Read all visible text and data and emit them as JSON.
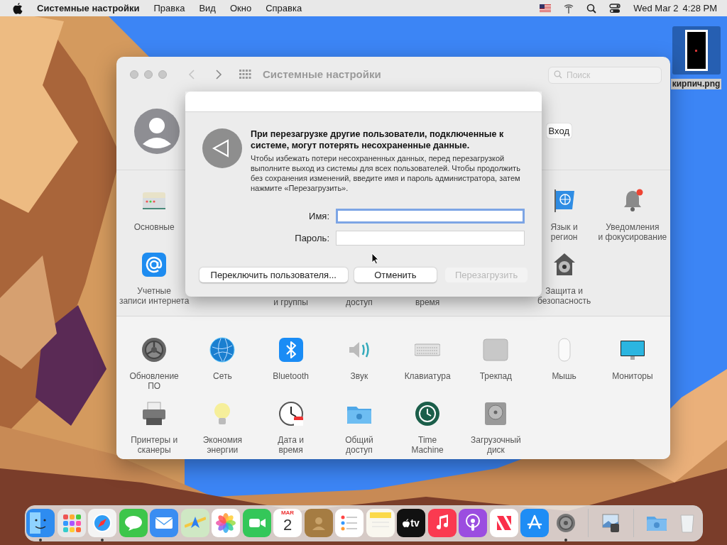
{
  "menu_bar": {
    "app_name": "Системные настройки",
    "menus": [
      "Правка",
      "Вид",
      "Окно",
      "Справка"
    ],
    "date": "Wed Mar 2",
    "time": "4:28 PM"
  },
  "desktop_file": {
    "name": "кирпич.png",
    "selected": true
  },
  "window": {
    "title": "Системные настройки",
    "search": {
      "placeholder": "Поиск"
    },
    "login_button": "Вход",
    "sections": [
      {
        "rows": [
          [
            {
              "kind": "general",
              "label": "Основные"
            },
            {
              "kind": "empty"
            },
            {
              "kind": "empty"
            },
            {
              "kind": "empty"
            },
            {
              "kind": "empty"
            },
            {
              "kind": "empty"
            },
            {
              "kind": "language",
              "label": "Язык и\nрегион"
            },
            {
              "kind": "notifications",
              "label": "Уведомления\nи фокусирование"
            }
          ],
          [
            {
              "kind": "internet",
              "label": "Учетные\nзаписи интернета"
            },
            {
              "kind": "empty"
            },
            {
              "kind": "covered",
              "label": "и группы"
            },
            {
              "kind": "covered",
              "label": "доступ"
            },
            {
              "kind": "covered",
              "label": "время"
            },
            {
              "kind": "empty"
            },
            {
              "kind": "security",
              "label": "Защита и\nбезопасность"
            },
            {
              "kind": "empty"
            }
          ]
        ]
      },
      {
        "rows": [
          [
            {
              "kind": "update",
              "label": "Обновление\nПО"
            },
            {
              "kind": "network",
              "label": "Сеть"
            },
            {
              "kind": "bluetooth",
              "label": "Bluetooth"
            },
            {
              "kind": "sound",
              "label": "Звук"
            },
            {
              "kind": "keyboard",
              "label": "Клавиатура"
            },
            {
              "kind": "trackpad",
              "label": "Трекпад"
            },
            {
              "kind": "mouse",
              "label": "Мышь"
            },
            {
              "kind": "displays",
              "label": "Мониторы"
            }
          ],
          [
            {
              "kind": "printers",
              "label": "Принтеры и\nсканеры"
            },
            {
              "kind": "energy",
              "label": "Экономия\nэнергии"
            },
            {
              "kind": "datetime",
              "label": "Дата и\nвремя"
            },
            {
              "kind": "sharing",
              "label": "Общий\nдоступ"
            },
            {
              "kind": "timemachine",
              "label": "Time\nMachine"
            },
            {
              "kind": "disk",
              "label": "Загрузочный\nдиск"
            },
            {
              "kind": "empty"
            },
            {
              "kind": "empty"
            }
          ]
        ]
      }
    ]
  },
  "sheet": {
    "title": "При перезагрузке другие пользователи, подключенные к системе, могут потерять несохраненные данные.",
    "message": "Чтобы избежать потери несохраненных данных, перед перезагрузкой выполните выход из системы для всех пользователей. Чтобы продолжить без сохранения изменений, введите имя и пароль администратора, затем нажмите «Перезагрузить».",
    "fields": [
      {
        "label": "Имя:",
        "focused": true
      },
      {
        "label": "Пароль:",
        "focused": false
      }
    ],
    "buttons": [
      {
        "label": "Переключить пользователя...",
        "disabled": false
      },
      {
        "label": "Отменить",
        "disabled": false
      },
      {
        "label": "Перезагрузить",
        "disabled": true
      }
    ]
  },
  "dock": [
    {
      "kind": "finder",
      "running": true
    },
    {
      "kind": "launchpad",
      "running": false
    },
    {
      "kind": "safari",
      "running": true
    },
    {
      "kind": "messages",
      "running": false
    },
    {
      "kind": "mail",
      "running": false
    },
    {
      "kind": "maps",
      "running": false
    },
    {
      "kind": "photos",
      "running": false
    },
    {
      "kind": "facetime",
      "running": false
    },
    {
      "kind": "calendar",
      "running": false,
      "month": "MAR",
      "day": "2"
    },
    {
      "kind": "contacts",
      "running": false
    },
    {
      "kind": "reminders",
      "running": false
    },
    {
      "kind": "notes",
      "running": false
    },
    {
      "kind": "tv",
      "running": false,
      "label": "tv"
    },
    {
      "kind": "music",
      "running": false
    },
    {
      "kind": "podcasts",
      "running": false
    },
    {
      "kind": "news",
      "running": false
    },
    {
      "kind": "appstore",
      "running": false
    },
    {
      "kind": "settings",
      "running": true
    },
    {
      "kind": "separator"
    },
    {
      "kind": "preview",
      "running": false
    },
    {
      "kind": "separator"
    },
    {
      "kind": "downloads",
      "running": false
    },
    {
      "kind": "trash",
      "running": false
    }
  ]
}
